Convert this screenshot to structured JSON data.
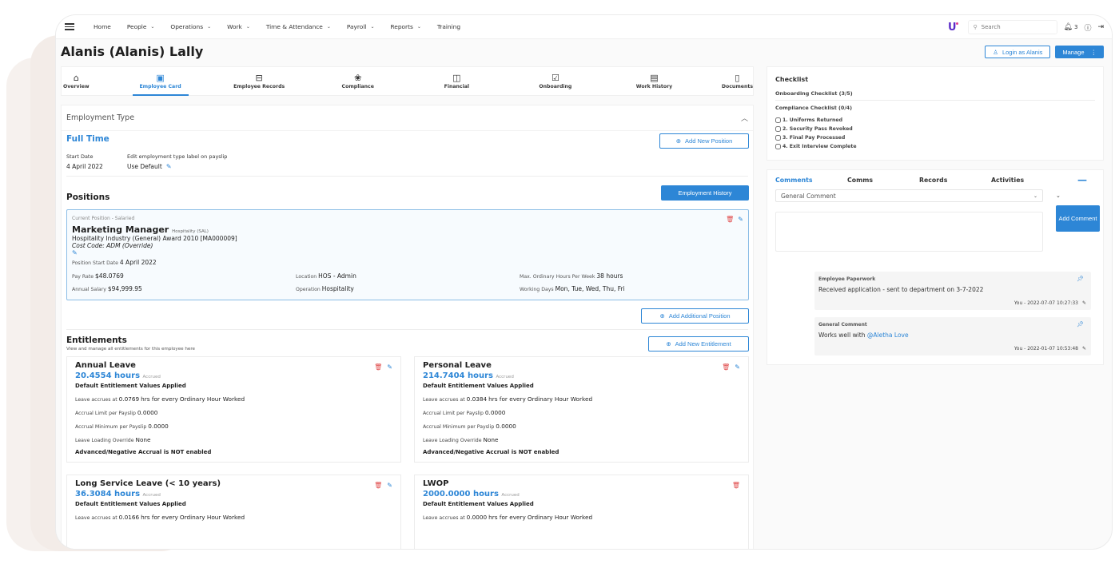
{
  "nav": {
    "items": [
      {
        "label": "Home",
        "dropdown": false
      },
      {
        "label": "People",
        "dropdown": true
      },
      {
        "label": "Operations",
        "dropdown": true
      },
      {
        "label": "Work",
        "dropdown": true
      },
      {
        "label": "Time & Attendance",
        "dropdown": true
      },
      {
        "label": "Payroll",
        "dropdown": true
      },
      {
        "label": "Reports",
        "dropdown": true
      },
      {
        "label": "Training",
        "dropdown": false
      }
    ],
    "logo": "U",
    "search_placeholder": "Search",
    "notification_count": "3"
  },
  "header": {
    "title": "Alanis (Alanis) Lally",
    "login_as": "Login as Alanis",
    "manage": "Manage"
  },
  "tabs": [
    {
      "label": "Overview",
      "icon": "home-icon",
      "glyph": "⌂"
    },
    {
      "label": "Employee Card",
      "icon": "badge-icon",
      "glyph": "▣",
      "active": true
    },
    {
      "label": "Employee Records",
      "icon": "archive-icon",
      "glyph": "⊟"
    },
    {
      "label": "Compliance",
      "icon": "medal-icon",
      "glyph": "❀"
    },
    {
      "label": "Financial",
      "icon": "wallet-icon",
      "glyph": "◫"
    },
    {
      "label": "Onboarding",
      "icon": "checklist-icon",
      "glyph": "☑"
    },
    {
      "label": "Work History",
      "icon": "history-icon",
      "glyph": "▤"
    },
    {
      "label": "Documents",
      "icon": "document-icon",
      "glyph": "▯"
    }
  ],
  "employment": {
    "section_title": "Employment Type",
    "type": "Full Time",
    "start_date_label": "Start Date",
    "start_date": "4 April 2022",
    "payslip_label": "Edit employment type label on payslip",
    "payslip_value": "Use Default",
    "add_position": "Add New Position"
  },
  "positions": {
    "title": "Positions",
    "history_button": "Employment History",
    "current": {
      "header": "Current Position - Salaried",
      "title": "Marketing Manager",
      "subtitle": "Hospitality (SAL)",
      "award": "Hospitality Industry (General) Award 2010 [MA000009]",
      "cost_code": "Cost Code: ADM (Override)",
      "start_label": "Position Start Date",
      "start_value": "4 April 2022",
      "pay_rate_label": "Pay Rate",
      "pay_rate": "$48.0769",
      "annual_salary_label": "Annual Salary",
      "annual_salary": "$94,999.95",
      "location_label": "Location",
      "location": "HOS - Admin",
      "operation_label": "Operation",
      "operation": "Hospitality",
      "max_hours_label": "Max. Ordinary Hours Per Week",
      "max_hours": "38 hours",
      "working_days_label": "Working Days",
      "working_days": "Mon, Tue, Wed, Thu, Fri"
    },
    "add_additional": "Add Additional Position"
  },
  "entitlements": {
    "title": "Entitlements",
    "subtitle": "View and manage all entitlements for this employee here",
    "add_button": "Add New Entitlement",
    "accrued_label": "Accrued",
    "items": [
      {
        "name": "Annual Leave",
        "hours": "20.4554 hours",
        "default_note": "Default Entitlement Values Applied",
        "accrues_prefix": "Leave accrues at",
        "accrues_rate": "0.0769",
        "accrues_mid": "hrs for every",
        "accrues_suffix": "Ordinary Hour Worked",
        "limit_label": "Accrual Limit per Payslip",
        "limit": "0.0000",
        "min_label": "Accrual Minimum per Payslip",
        "min": "0.0000",
        "loading_label": "Leave Loading Override",
        "loading": "None",
        "negative_note": "Advanced/Negative Accrual is NOT enabled",
        "editable": true
      },
      {
        "name": "Personal Leave",
        "hours": "214.7404 hours",
        "default_note": "Default Entitlement Values Applied",
        "accrues_prefix": "Leave accrues at",
        "accrues_rate": "0.0384",
        "accrues_mid": "hrs for every",
        "accrues_suffix": "Ordinary Hour Worked",
        "limit_label": "Accrual Limit per Payslip",
        "limit": "0.0000",
        "min_label": "Accrual Minimum per Payslip",
        "min": "0.0000",
        "loading_label": "Leave Loading Override",
        "loading": "None",
        "negative_note": "Advanced/Negative Accrual is NOT enabled",
        "editable": true
      },
      {
        "name": "Long Service Leave (< 10 years)",
        "hours": "36.3084 hours",
        "default_note": "Default Entitlement Values Applied",
        "accrues_prefix": "Leave accrues at",
        "accrues_rate": "0.0166",
        "accrues_mid": "hrs for every",
        "accrues_suffix": "Ordinary Hour Worked",
        "editable": true
      },
      {
        "name": "LWOP",
        "hours": "2000.0000 hours",
        "default_note": "Default Entitlement Values Applied",
        "accrues_prefix": "Leave accrues at",
        "accrues_rate": "0.0000",
        "accrues_mid": "hrs for every",
        "accrues_suffix": "Ordinary Hour Worked",
        "editable": false
      }
    ]
  },
  "checklist": {
    "title": "Checklist",
    "onboarding": "Onboarding Checklist (3/5)",
    "compliance": "Compliance Checklist (0/4)",
    "items": [
      {
        "label": "1. Uniforms Returned",
        "checked": false
      },
      {
        "label": "2. Security Pass Revoked",
        "checked": false
      },
      {
        "label": "3. Final Pay Processed",
        "checked": false
      },
      {
        "label": "4. Exit Interview Complete",
        "checked": false
      }
    ]
  },
  "comments": {
    "tabs": [
      "Comments",
      "Comms",
      "Records",
      "Activities"
    ],
    "active_tab": "Comments",
    "type_selected": "General Comment",
    "add_button": "Add Comment",
    "items": [
      {
        "type": "Employee Paperwork",
        "body": "Received application - sent to department on 3-7-2022",
        "mention": "",
        "meta": "You - 2022-07-07 10:27:33"
      },
      {
        "type": "General Comment",
        "body": "Works well with ",
        "mention": "@Aletha Love",
        "meta": "You - 2022-01-07 10:53:48"
      }
    ]
  }
}
